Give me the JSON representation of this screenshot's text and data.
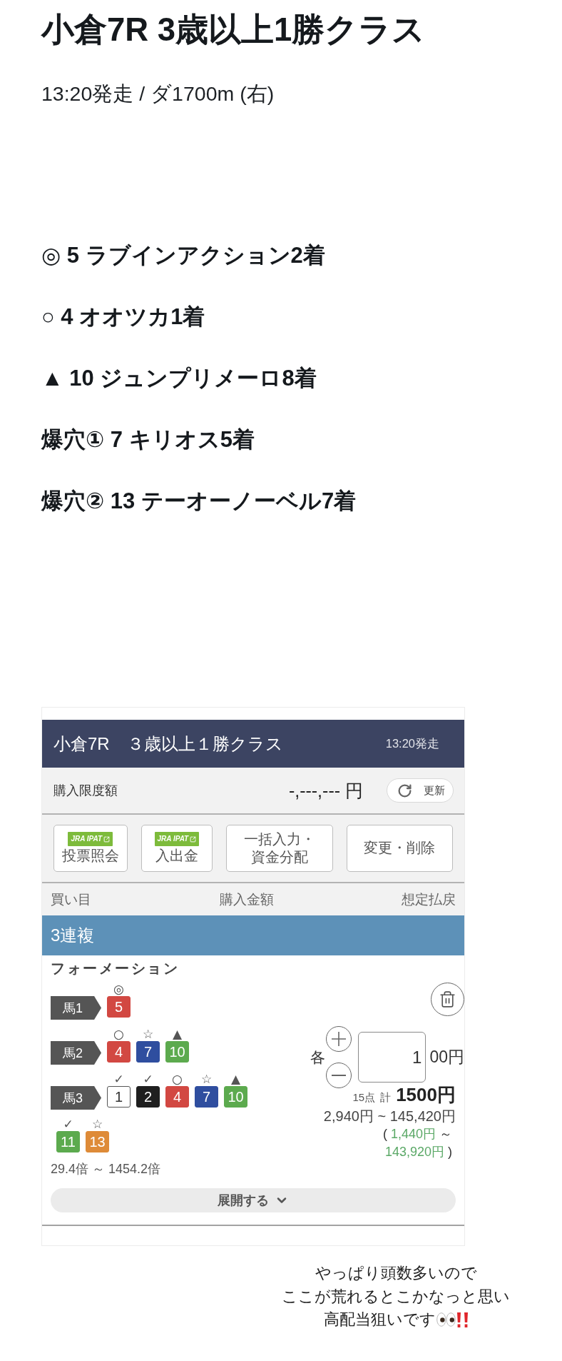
{
  "race": {
    "title": "小倉7R 3歳以上1勝クラス",
    "subtitle": "13:20発走 / ダ1700m (右)"
  },
  "picks": [
    {
      "text": "◎ 5 ラブインアクション2着"
    },
    {
      "text": "○ 4 オオツカ1着"
    },
    {
      "text": "▲ 10 ジュンプリメーロ8着"
    },
    {
      "text": "爆穴① 7 キリオス5着"
    },
    {
      "text": "爆穴② 13 テーオーノーベル7着"
    }
  ],
  "betting_card": {
    "header": {
      "title": "小倉7R　３歳以上１勝クラス",
      "post_time": "13:20発走"
    },
    "purchase_limit": {
      "label": "購入限度額",
      "amount": "-,---,--- 円",
      "refresh_button": "更新"
    },
    "actions": [
      {
        "kind": "ipat",
        "badge": "JRA IPAT",
        "lines": [
          "投票照会"
        ]
      },
      {
        "kind": "ipat",
        "badge": "JRA IPAT",
        "lines": [
          "入出金"
        ]
      },
      {
        "kind": "plain",
        "lines": [
          "一括入力・",
          "資金分配"
        ]
      },
      {
        "kind": "plain",
        "lines": [
          "変更・削除"
        ]
      }
    ],
    "columns": [
      "買い目",
      "購入金額",
      "想定払戻"
    ],
    "bet": {
      "type": "3連複",
      "method": "フォーメーション",
      "legs": [
        {
          "label": "馬1",
          "horses": [
            {
              "number": "5",
              "mark": "◎",
              "color": "#d24842"
            }
          ]
        },
        {
          "label": "馬2",
          "horses": [
            {
              "number": "4",
              "mark": "○",
              "color": "#d24842"
            },
            {
              "number": "7",
              "mark": "☆",
              "color": "#2f4e9f"
            },
            {
              "number": "10",
              "mark": "▲",
              "color": "#5caa4e"
            }
          ]
        },
        {
          "label": "馬3",
          "horses": [
            {
              "number": "1",
              "mark": "✓",
              "color": "#ffffff"
            },
            {
              "number": "2",
              "mark": "✓",
              "color": "#1f1f1f"
            },
            {
              "number": "4",
              "mark": "○",
              "color": "#d24842"
            },
            {
              "number": "7",
              "mark": "☆",
              "color": "#2f4e9f"
            },
            {
              "number": "10",
              "mark": "▲",
              "color": "#5caa4e"
            },
            {
              "number": "11",
              "mark": "✓",
              "color": "#5caa4e"
            },
            {
              "number": "13",
              "mark": "☆",
              "color": "#de8b38"
            }
          ]
        }
      ],
      "odds": "29.4倍 ～ 1454.2倍",
      "each_label": "各",
      "amount": "1",
      "unit": "00円",
      "points": "15点",
      "total_label": "計",
      "total": "1500円",
      "payout": "2,940円 ~ 145,420円",
      "net_payout": {
        "open": "(",
        "min": "1,440円",
        "separator": "～",
        "max": "143,920円",
        "close": ")"
      },
      "expand_button": "展開する"
    }
  },
  "caption": {
    "lines": [
      "やっぱり頭数多いので",
      "ここが荒れるとこかなっと思い",
      "高配当狙いです"
    ]
  }
}
